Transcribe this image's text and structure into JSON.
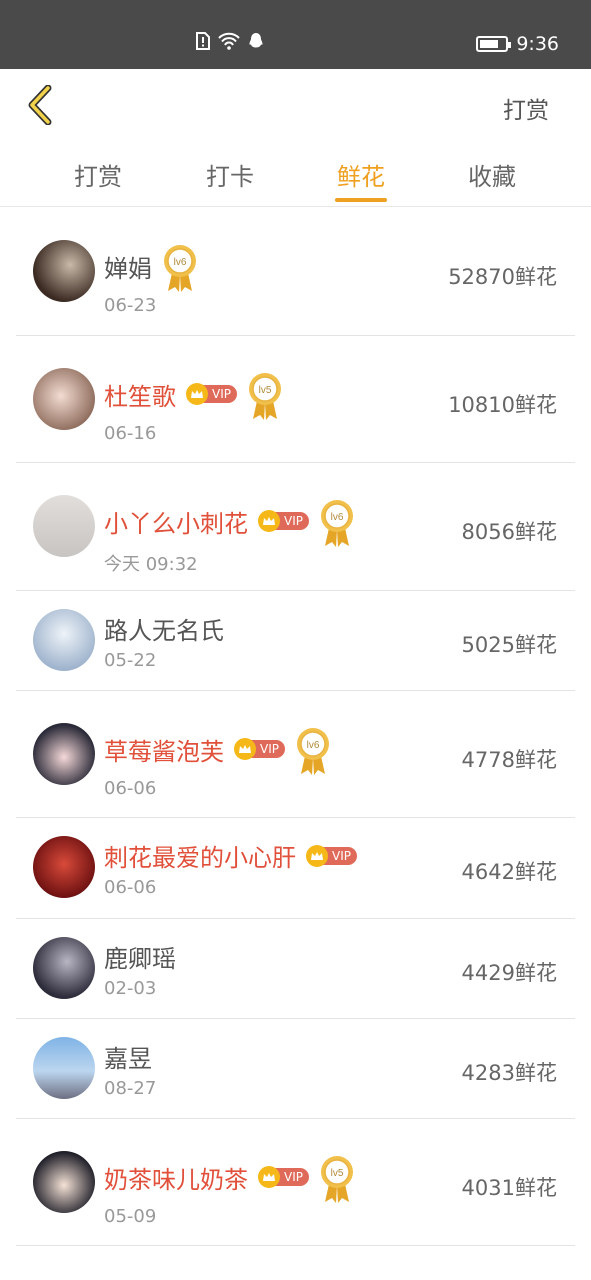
{
  "status_bar": {
    "time": "9:36",
    "battery_level": 0.75
  },
  "header": {
    "back_icon": "chevron-left-icon",
    "action_label": "打赏"
  },
  "tabs": [
    {
      "label": "打赏",
      "active": false
    },
    {
      "label": "打卡",
      "active": false
    },
    {
      "label": "鲜花",
      "active": true
    },
    {
      "label": "收藏",
      "active": false
    }
  ],
  "rows": [
    {
      "name": "婵娟",
      "date": "06-23",
      "count": "52870鲜花",
      "vip": false,
      "vip_label": "",
      "medal": "lv6"
    },
    {
      "name": "杜笙歌",
      "date": "06-16",
      "count": "10810鲜花",
      "vip": true,
      "vip_label": "VIP",
      "medal": "lv5"
    },
    {
      "name": "小丫么小刺花",
      "date": "今天 09:32",
      "count": "8056鲜花",
      "vip": true,
      "vip_label": "VIP",
      "medal": "lv6"
    },
    {
      "name": "路人无名氏",
      "date": "05-22",
      "count": "5025鲜花",
      "vip": false,
      "vip_label": "",
      "medal": ""
    },
    {
      "name": "草莓酱泡芙",
      "date": "06-06",
      "count": "4778鲜花",
      "vip": true,
      "vip_label": "VIP",
      "medal": "lv6"
    },
    {
      "name": "刺花最爱的小心肝",
      "date": "06-06",
      "count": "4642鲜花",
      "vip": true,
      "vip_label": "VIP",
      "medal": ""
    },
    {
      "name": "鹿卿瑶",
      "date": "02-03",
      "count": "4429鲜花",
      "vip": false,
      "vip_label": "",
      "medal": ""
    },
    {
      "name": "嘉昱",
      "date": "08-27",
      "count": "4283鲜花",
      "vip": false,
      "vip_label": "",
      "medal": ""
    },
    {
      "name": "奶茶味儿奶茶",
      "date": "05-09",
      "count": "4031鲜花",
      "vip": true,
      "vip_label": "VIP",
      "medal": "lv5"
    }
  ],
  "colors": {
    "accent": "#f0a020",
    "vip_name": "#e0503a",
    "status_bar": "#4a4a4a"
  }
}
